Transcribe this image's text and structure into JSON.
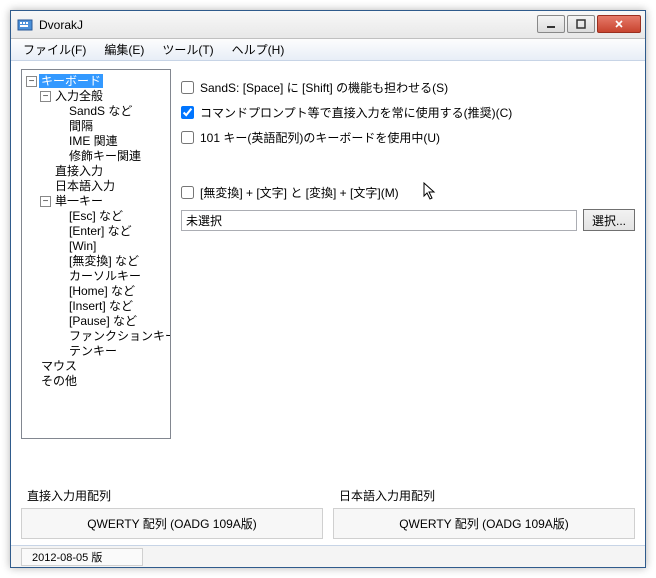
{
  "window": {
    "title": "DvorakJ"
  },
  "menubar": {
    "file": "ファイル(F)",
    "edit": "編集(E)",
    "tool": "ツール(T)",
    "help": "ヘルプ(H)"
  },
  "tree": {
    "keyboard": "キーボード",
    "input_general": "入力全般",
    "sands": "SandS など",
    "interval": "間隔",
    "ime": "IME 関連",
    "modkey": "修飾キー関連",
    "direct_input": "直接入力",
    "jp_input": "日本語入力",
    "single_key": "単一キー",
    "esc": "[Esc] など",
    "enter": "[Enter] など",
    "win": "[Win]",
    "muhenkan": "[無変換] など",
    "cursor": "カーソルキー",
    "home": "[Home] など",
    "insert": "[Insert] など",
    "pause": "[Pause] など",
    "function": "ファンクションキー",
    "tenkey": "テンキー",
    "mouse": "マウス",
    "other": "その他"
  },
  "options": {
    "sands_label": "SandS: [Space] に [Shift] の機能も担わせる(S)",
    "sands_checked": false,
    "cmd_label": "コマンドプロンプト等で直接入力を常に使用する(推奨)(C)",
    "cmd_checked": true,
    "us101_label": "101 キー(英語配列)のキーボードを使用中(U)",
    "us101_checked": false,
    "muhenkan_combo_label": "[無変換] + [文字] と [変換] + [文字](M)",
    "muhenkan_combo_checked": false,
    "combo_value": "未選択",
    "browse_label": "選択..."
  },
  "layouts": {
    "direct_label": "直接入力用配列",
    "direct_value": "QWERTY 配列 (OADG 109A版)",
    "jp_label": "日本語入力用配列",
    "jp_value": "QWERTY 配列 (OADG 109A版)"
  },
  "status": {
    "version": "2012-08-05 版"
  }
}
